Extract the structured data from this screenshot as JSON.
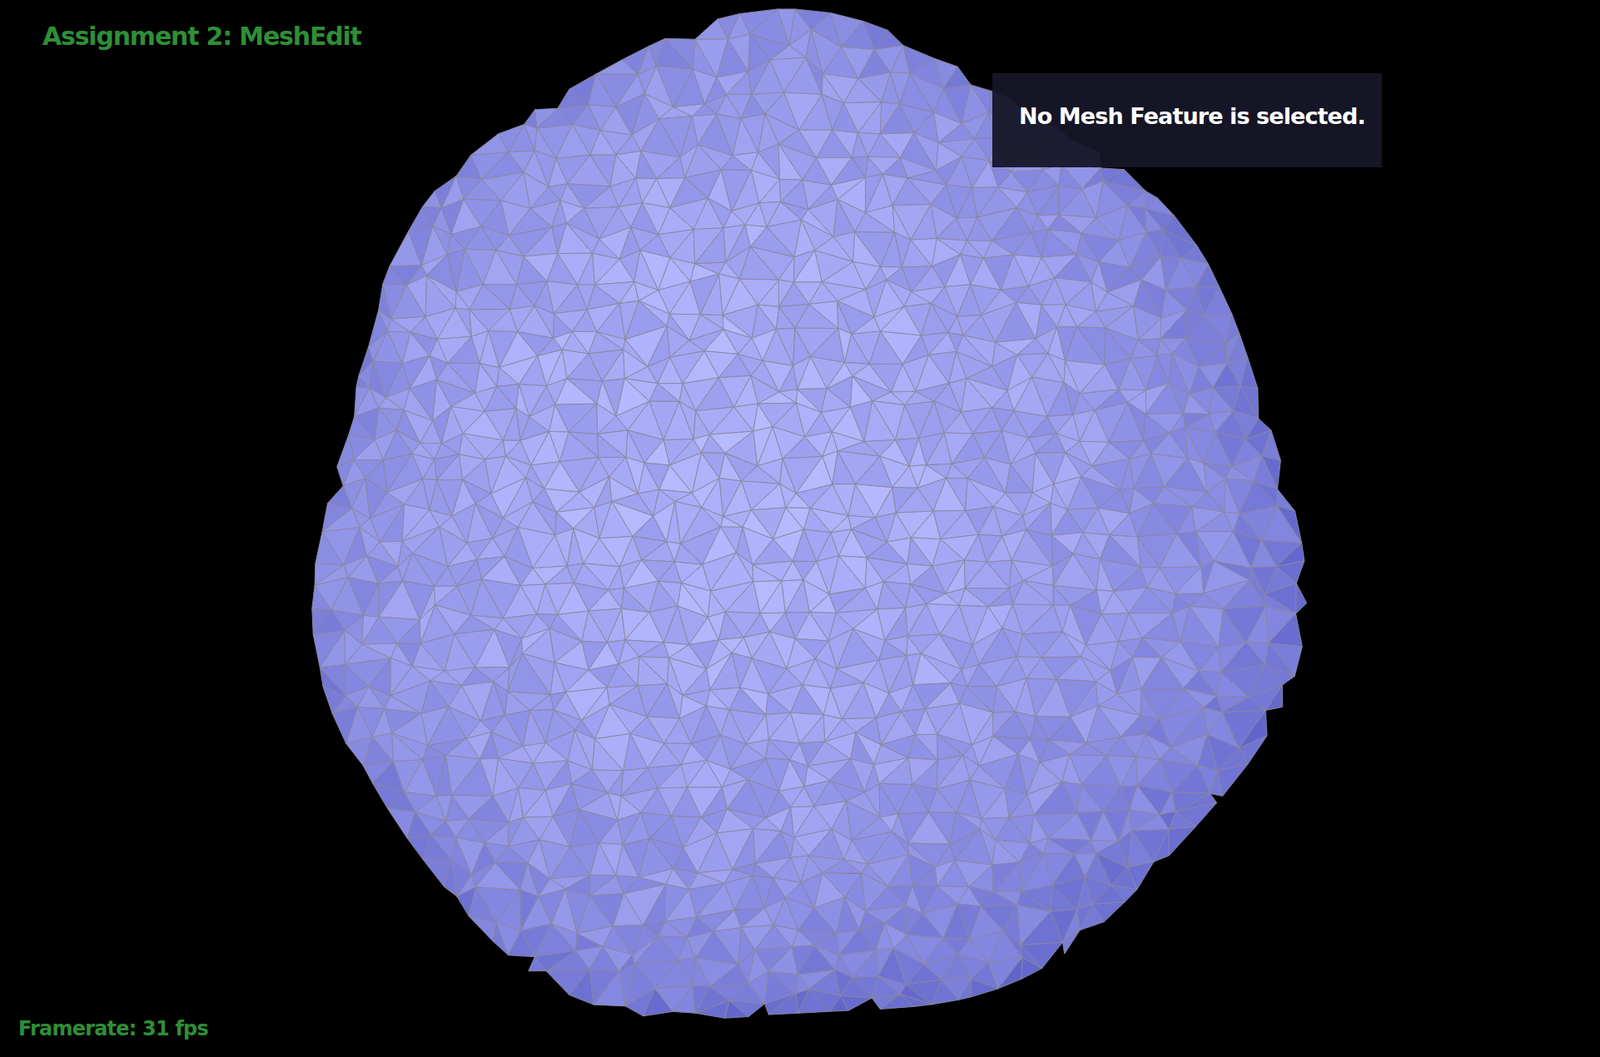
{
  "app": {
    "title": "Assignment 2: MeshEdit"
  },
  "info_panel": {
    "message": "No Mesh Feature is selected."
  },
  "status": {
    "framerate": "Framerate: 31 fps"
  }
}
